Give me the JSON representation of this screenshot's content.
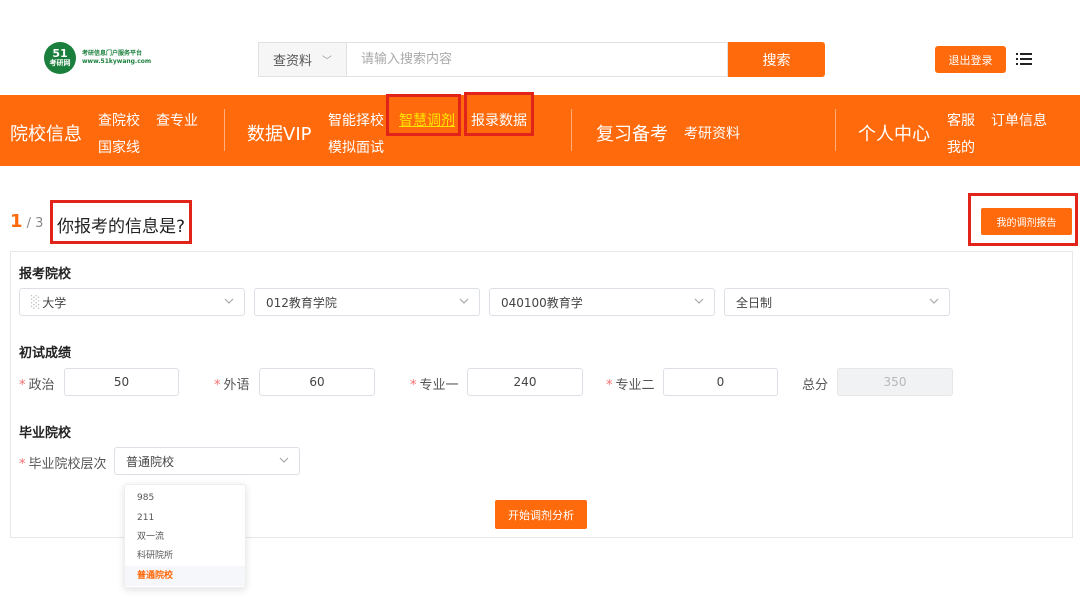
{
  "header": {
    "logo": {
      "badge_top": "51",
      "badge_bottom": "考研网",
      "tagline": "考研信息门户服务平台",
      "url_text": "www.51kywang.com"
    },
    "search": {
      "type_label": "查资料",
      "placeholder": "请输入搜索内容",
      "button_label": "搜索"
    },
    "logout_label": "退出登录",
    "menu_icon": "list-icon"
  },
  "nav": {
    "groups": [
      {
        "title": "院校信息",
        "links": [
          "查院校",
          "查专业",
          "国家线"
        ]
      },
      {
        "title": "数据VIP",
        "links": [
          "智能择校",
          "智慧调剂",
          "报录数据",
          "模拟面试"
        ]
      },
      {
        "title": "复习备考",
        "links": [
          "考研资料"
        ]
      },
      {
        "title": "个人中心",
        "links": [
          "客服",
          "订单信息",
          "我的"
        ]
      }
    ],
    "active_link": "智慧调剂",
    "accent_color": "#ff6a0c"
  },
  "step": {
    "current": "1",
    "total": "/ 3"
  },
  "page_title": "你报考的信息是?",
  "report_button": "我的调剂报告",
  "form": {
    "target": {
      "label": "报考院校",
      "school": "大学",
      "department": "012教育学院",
      "major": "040100教育学",
      "mode": "全日制"
    },
    "scores": {
      "label": "初试成绩",
      "politics": {
        "label": "政治",
        "value": "50"
      },
      "language": {
        "label": "外语",
        "value": "60"
      },
      "major1": {
        "label": "专业一",
        "value": "240"
      },
      "major2": {
        "label": "专业二",
        "value": "0"
      },
      "total": {
        "label": "总分",
        "value": "350"
      }
    },
    "graduate": {
      "label": "毕业院校",
      "level_label": "毕业院校层次",
      "level_value": "普通院校",
      "options": [
        "985",
        "211",
        "双一流",
        "科研院所",
        "普通院校"
      ]
    },
    "start_button": "开始调剂分析"
  }
}
